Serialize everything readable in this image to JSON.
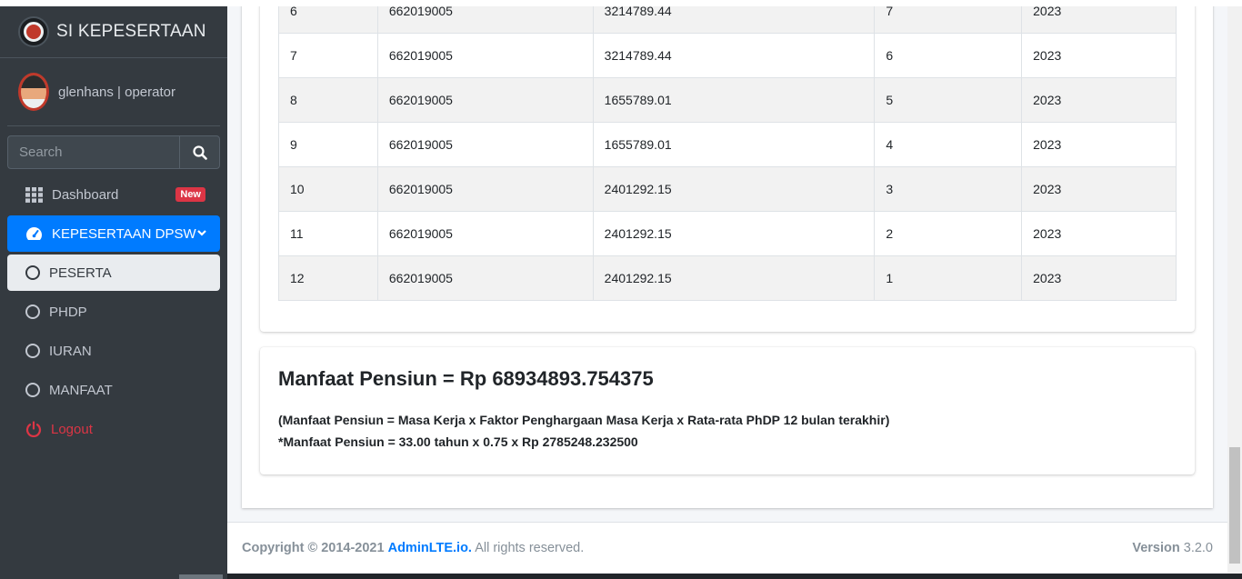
{
  "brand": {
    "name": "SI KEPESERTAAN"
  },
  "user": {
    "name": "glenhans | operator"
  },
  "search": {
    "placeholder": "Search"
  },
  "nav": {
    "dashboard": "Dashboard",
    "dashboard_badge": "New",
    "kepesertaan": "KEPESERTAAN DPSW",
    "peserta": "PESERTA",
    "phdp": "PHDP",
    "iuran": "IURAN",
    "manfaat": "MANFAAT",
    "logout": "Logout"
  },
  "table": {
    "rows": [
      [
        "6",
        "662019005",
        "3214789.44",
        "7",
        "2023"
      ],
      [
        "7",
        "662019005",
        "3214789.44",
        "6",
        "2023"
      ],
      [
        "8",
        "662019005",
        "1655789.01",
        "5",
        "2023"
      ],
      [
        "9",
        "662019005",
        "1655789.01",
        "4",
        "2023"
      ],
      [
        "10",
        "662019005",
        "2401292.15",
        "3",
        "2023"
      ],
      [
        "11",
        "662019005",
        "2401292.15",
        "2",
        "2023"
      ],
      [
        "12",
        "662019005",
        "2401292.15",
        "1",
        "2023"
      ]
    ]
  },
  "manfaat": {
    "title": "Manfaat Pensiun = Rp 68934893.754375",
    "formula": "(Manfaat Pensiun = Masa Kerja x Faktor Penghargaan Masa Kerja x Rata-rata PhDP 12 bulan terakhir)",
    "calc": "*Manfaat Pensiun = 33.00 tahun x 0.75 x Rp 2785248.232500"
  },
  "footer": {
    "copyright": "Copyright © 2014-2021",
    "link": "AdminLTE.io.",
    "rights": "All rights reserved.",
    "version_label": "Version",
    "version": "3.2.0"
  },
  "colors": {
    "primary": "#007bff",
    "danger": "#dc3545",
    "sidebar": "#343a40"
  }
}
